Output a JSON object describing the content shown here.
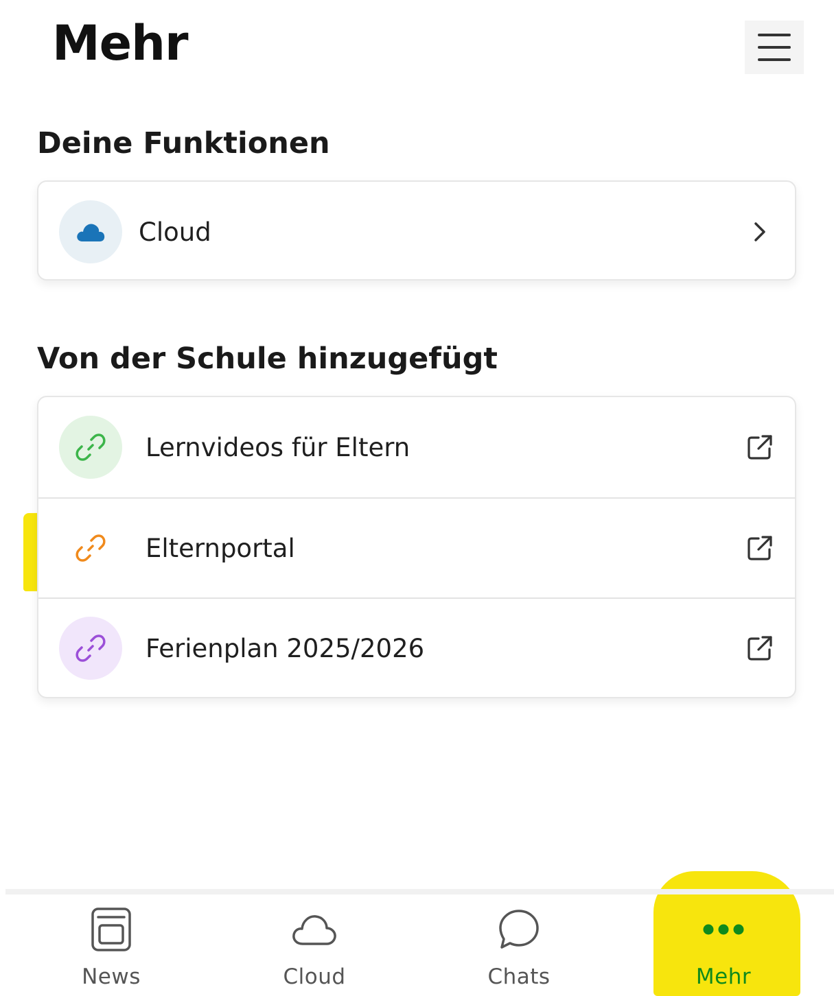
{
  "header": {
    "title": "Mehr",
    "menu_icon": "hamburger-menu-icon"
  },
  "sections": {
    "functions": {
      "heading": "Deine Funktionen",
      "items": [
        {
          "label": "Cloud",
          "icon": "cloud-icon",
          "icon_color": "#1a74b8",
          "icon_bg": "#e8f0f5",
          "trailing": "chevron-right-icon"
        }
      ]
    },
    "school": {
      "heading": "Von der Schule hinzugefügt",
      "items": [
        {
          "label": "Lernvideos für Eltern",
          "icon": "link-icon",
          "icon_color": "#3cb54a",
          "icon_bg": "#e3f4e3",
          "trailing": "external-link-icon"
        },
        {
          "label": "Elternportal",
          "icon": "link-icon",
          "icon_color": "#f08a1c",
          "icon_bg": "#fdeedd",
          "trailing": "external-link-icon"
        },
        {
          "label": "Ferienplan 2025/2026",
          "icon": "link-icon",
          "icon_color": "#9b4fd8",
          "icon_bg": "#f1e6fb",
          "trailing": "external-link-icon"
        }
      ]
    }
  },
  "bottom_nav": {
    "items": [
      {
        "label": "News",
        "icon": "news-icon",
        "active": false
      },
      {
        "label": "Cloud",
        "icon": "cloud-outline-icon",
        "active": false
      },
      {
        "label": "Chats",
        "icon": "chat-bubble-icon",
        "active": false
      },
      {
        "label": "Mehr",
        "icon": "more-dots-icon",
        "active": true
      }
    ],
    "active_color": "#0f8a1c"
  },
  "colors": {
    "highlighter": "#f7e400"
  }
}
